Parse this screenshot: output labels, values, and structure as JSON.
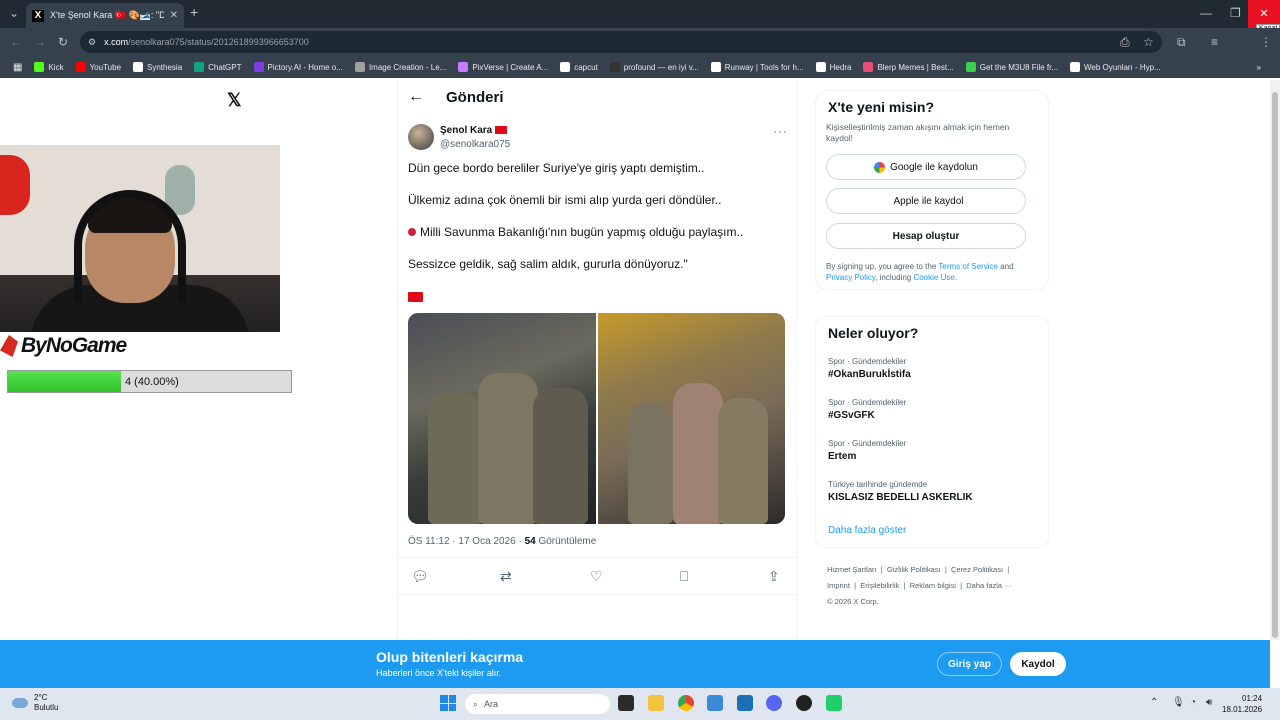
{
  "browser": {
    "tab_title": "X'te Şenol Kara 🇹🇷 🎨🎿: \"Dün g",
    "tab_favicon": "X",
    "url_host": "x.com",
    "url_path": "/senolkara075/status/2012618993966653700",
    "tooltip_close": "Kapat",
    "bookmarks": [
      {
        "label": "Kick",
        "color": "#53fc18"
      },
      {
        "label": "YouTube",
        "color": "#ff0000"
      },
      {
        "label": "Synthesia",
        "color": "#ffffff"
      },
      {
        "label": "ChatGPT",
        "color": "#10a37f"
      },
      {
        "label": "Pictory.AI - Home o...",
        "color": "#7b3fe4"
      },
      {
        "label": "Image Creation - Le...",
        "color": "#a0a0a0"
      },
      {
        "label": "PixVerse | Create A...",
        "color": "#c77dff"
      },
      {
        "label": "capcut",
        "color": "#ffffff"
      },
      {
        "label": "profound — en iyi v...",
        "color": "#333333"
      },
      {
        "label": "Runway | Tools for h...",
        "color": "#ffffff"
      },
      {
        "label": "Hedra",
        "color": "#ffffff"
      },
      {
        "label": "Blerp Memes | Best...",
        "color": "#e94e77"
      },
      {
        "label": "Get the M3U8 File fr...",
        "color": "#3ccf4e"
      },
      {
        "label": "Web Oyunları - Hyp...",
        "color": "#ffffff"
      }
    ]
  },
  "overlay": {
    "brand": "ByNoGame",
    "progress_label": "4 (40.00%)",
    "progress_fraction": 0.4
  },
  "post": {
    "header": "Gönderi",
    "author_name": "Şenol Kara",
    "author_handle": "@senolkara075",
    "lines": [
      "Dün gece bordo bereliler Suriye'ye giriş yaptı demiştim..",
      "Ülkemiz adına çok önemli bir ismi alıp yurda geri döndüler..",
      "Milli Savunma Bakanlığı'nın bugün yapmış olduğu paylaşım..",
      "Sessizce geldik, sağ salim aldık, gururla dönüyoruz.\""
    ],
    "time": "ÖS 11:12 · 17 Oca 2026 · ",
    "views": "54",
    "views_label": " Görüntüleme"
  },
  "signup_card": {
    "title": "X'te yeni misin?",
    "subtitle": "Kişiselleştirilmiş zaman akışını almak için hemen kaydol!",
    "google": "Google ile kaydolun",
    "apple": "Apple ile kaydol",
    "create": "Hesap oluştur",
    "terms_pre": "By signing up, you agree to the ",
    "terms_link": "Terms of Service",
    "terms_and": " and ",
    "privacy_link": "Privacy Policy",
    "terms_mid": ", including ",
    "cookie_link": "Cookie Use",
    "terms_end": "."
  },
  "trends": {
    "title": "Neler oluyor?",
    "items": [
      {
        "category": "Spor · Gündemdekiler",
        "name": "#OkanBurukİstifa"
      },
      {
        "category": "Spor · Gündemdekiler",
        "name": "#GSvGFK"
      },
      {
        "category": "Spor · Gündemdekiler",
        "name": "Ertem"
      },
      {
        "category": "Türkiye tarihinde gündemde",
        "name": "KISLASIZ BEDELLI ASKERLIK"
      }
    ],
    "show_more": "Daha fazla göster"
  },
  "footer": {
    "links": [
      "Hizmet Şartları",
      "Gizlilik Politikası",
      "Çerez Politikası",
      "Imprint",
      "Erişilebilirlik",
      "Reklam bilgisi",
      "Daha fazla ···"
    ],
    "copyright": "© 2026 X Corp."
  },
  "banner": {
    "title": "Olup bitenleri kaçırma",
    "subtitle": "Haberleri önce X'teki kişiler alır.",
    "login": "Giriş yap",
    "signup": "Kaydol"
  },
  "taskbar": {
    "temp": "2°C",
    "weather": "Bulutlu",
    "search": "Ara",
    "time": "01:24",
    "date": "18.01.2026"
  }
}
